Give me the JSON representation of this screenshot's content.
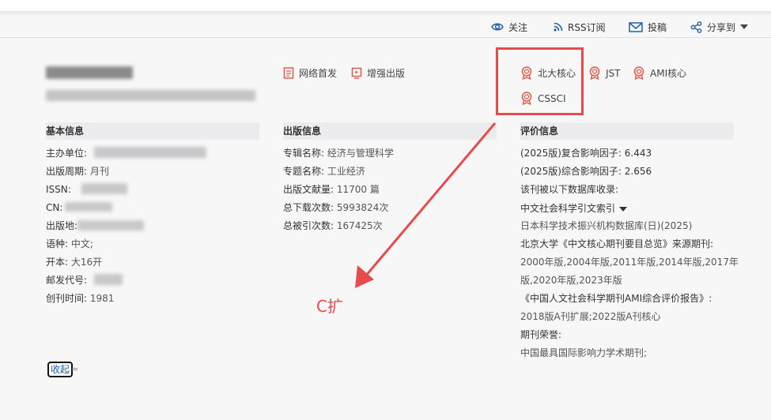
{
  "toolbar": {
    "follow_label": "关注",
    "rss_label": "RSS订阅",
    "submit_label": "投稿",
    "share_label": "分享到"
  },
  "publish_flags": {
    "online_first": "网络首发",
    "enhanced": "增强出版"
  },
  "badges": [
    "北大核心",
    "JST",
    "AMI核心",
    "CSSCI"
  ],
  "basic_info": {
    "heading": "基本信息",
    "sponsor_label": "主办单位:",
    "cycle_label": "出版周期:",
    "cycle_value": "月刊",
    "issn_label": "ISSN:",
    "cn_label": "CN:",
    "place_label": "出版地:",
    "language_label": "语种:",
    "language_value": "中文;",
    "format_label": "开本:",
    "format_value": "大16开",
    "postcode_label": "邮发代号:",
    "founded_label": "创刊时间:",
    "founded_value": "1981"
  },
  "publish_info": {
    "heading": "出版信息",
    "album_label": "专辑名称:",
    "album_value": "经济与管理科学",
    "topic_label": "专题名称:",
    "topic_value": "工业经济",
    "docs_label": "出版文献量:",
    "docs_value": "11700 篇",
    "downloads_label": "总下载次数:",
    "downloads_value": "5993824次",
    "citations_label": "总被引次数:",
    "citations_value": "167425次"
  },
  "evaluation": {
    "heading": "评价信息",
    "composite_if": "(2025版)复合影响因子: 6.443",
    "comprehensive_if": "(2025版)综合影响因子: 2.656",
    "db_intro": "该刊被以下数据库收录:",
    "cssci_dropdown": "中文社会科学引文索引",
    "jst_db": "日本科学技术振兴机构数据库(日)(2025)",
    "pku_label": "北京大学《中文核心期刊要目总览》来源期刊:",
    "pku_years_1": "2000年版,2004年版,2011年版,2014年版,2017年",
    "pku_years_2": "版,2020年版,2023年版",
    "ami_label": "《中国人文社会科学期刊AMI综合评价报告》:",
    "ami_value": "2018版A刊扩展;2022版A刊核心",
    "honor_label": "期刊荣誉:",
    "honor_value": "中国最具国际影响力学术期刊;"
  },
  "annotation": {
    "text": "C扩",
    "color": "#e84b4b"
  },
  "collapse": {
    "label": "收起",
    "tail": "≈"
  },
  "colors": {
    "badge_red": "#e05a4a",
    "toolbar_blue": "#1f5fa8",
    "link_blue": "#1a5fb4"
  }
}
